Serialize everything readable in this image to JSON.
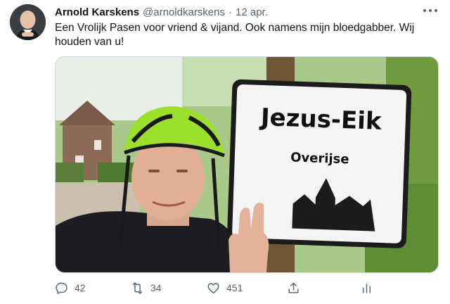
{
  "tweet": {
    "author_name": "Arnold Karskens",
    "handle": "@arnoldkarskens",
    "separator": "·",
    "date": "12 apr.",
    "text": "Een Vrolijk Pasen voor vriend & vijand. Ook namens mijn bloedgabber. Wij houden van u!"
  },
  "media": {
    "sign_title": "Jezus-Eik",
    "sign_subtitle": "Overijse"
  },
  "actions": {
    "reply_count": "42",
    "retweet_count": "34",
    "like_count": "451"
  },
  "icons": {
    "more": "more-horizontal-icon",
    "reply": "reply-icon",
    "retweet": "retweet-icon",
    "like": "heart-icon",
    "share": "share-icon",
    "analytics": "analytics-icon"
  },
  "colors": {
    "secondary_text": "#536471",
    "primary_text": "#0f1419",
    "helmet_green": "#9be02a"
  }
}
